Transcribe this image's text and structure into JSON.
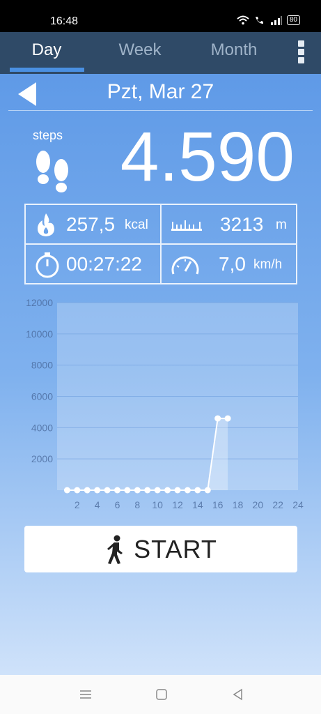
{
  "status_bar": {
    "time": "16:48",
    "battery": "80",
    "icons": [
      "wifi-icon",
      "call-icon",
      "signal-icon",
      "battery-icon"
    ]
  },
  "tabs": [
    {
      "label": "Day",
      "active": true
    },
    {
      "label": "Week",
      "active": false
    },
    {
      "label": "Month",
      "active": false
    }
  ],
  "date_nav": {
    "date": "Pzt, Mar 27"
  },
  "steps": {
    "label": "steps",
    "value": "4.590"
  },
  "stats": {
    "calories": {
      "value": "257,5",
      "unit": "kcal"
    },
    "distance": {
      "value": "3213",
      "unit": "m"
    },
    "duration": {
      "value": "00:27:22"
    },
    "speed": {
      "value": "7,0",
      "unit": "km/h"
    }
  },
  "start_button": {
    "label": "START"
  },
  "colors": {
    "background_top": "#5f9ae7",
    "tab_bar": "#2f4a67",
    "tab_accent": "#4a90e2"
  },
  "chart_data": {
    "type": "area",
    "x": [
      1,
      2,
      3,
      4,
      5,
      6,
      7,
      8,
      9,
      10,
      11,
      12,
      13,
      14,
      15,
      16,
      17
    ],
    "values": [
      0,
      0,
      0,
      0,
      0,
      0,
      0,
      0,
      0,
      0,
      0,
      0,
      0,
      0,
      0,
      4590,
      4590
    ],
    "x_ticks": [
      "2",
      "4",
      "6",
      "8",
      "10",
      "12",
      "14",
      "16",
      "18",
      "20",
      "22",
      "24"
    ],
    "y_ticks": [
      "2000",
      "4000",
      "6000",
      "8000",
      "10000",
      "12000"
    ],
    "xlim": [
      0,
      24
    ],
    "ylim": [
      0,
      12000
    ],
    "grid": true
  }
}
